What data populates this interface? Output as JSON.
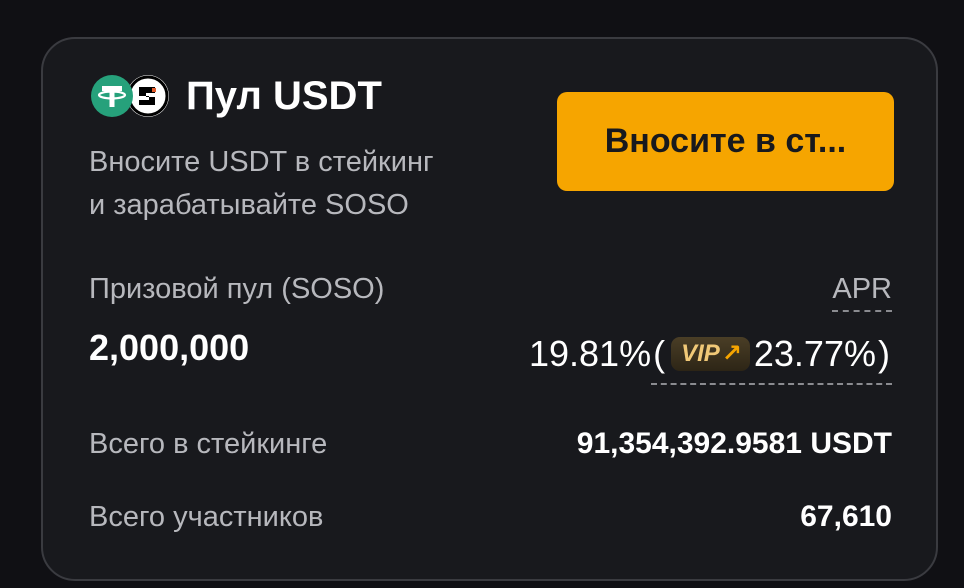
{
  "card": {
    "title": "Пул USDT",
    "icons": [
      "usdt-coin-icon",
      "soso-coin-icon"
    ],
    "description_line1": "Вносите USDT в стейкинг",
    "description_line2": "и зарабатывайте SOSO",
    "button_label": "Вносите в ст...",
    "prize_pool_label": "Призовой пул (SOSO)",
    "prize_pool_value": "2,000,000",
    "apr_label": "APR",
    "apr_value": "19.81%",
    "paren_open": "(",
    "vip_label": "VIP",
    "vip_apr_value": "23.77%",
    "paren_close": ")",
    "total_staked_label": "Всего в стейкинге",
    "total_staked_value": "91,354,392.9581 USDT",
    "participants_label": "Всего участников",
    "participants_value": "67,610"
  },
  "colors": {
    "background": "#101014",
    "card": "#18191d",
    "accent": "#f6a500",
    "usdt": "#26a17b",
    "text_secondary": "#b7b8bd"
  }
}
